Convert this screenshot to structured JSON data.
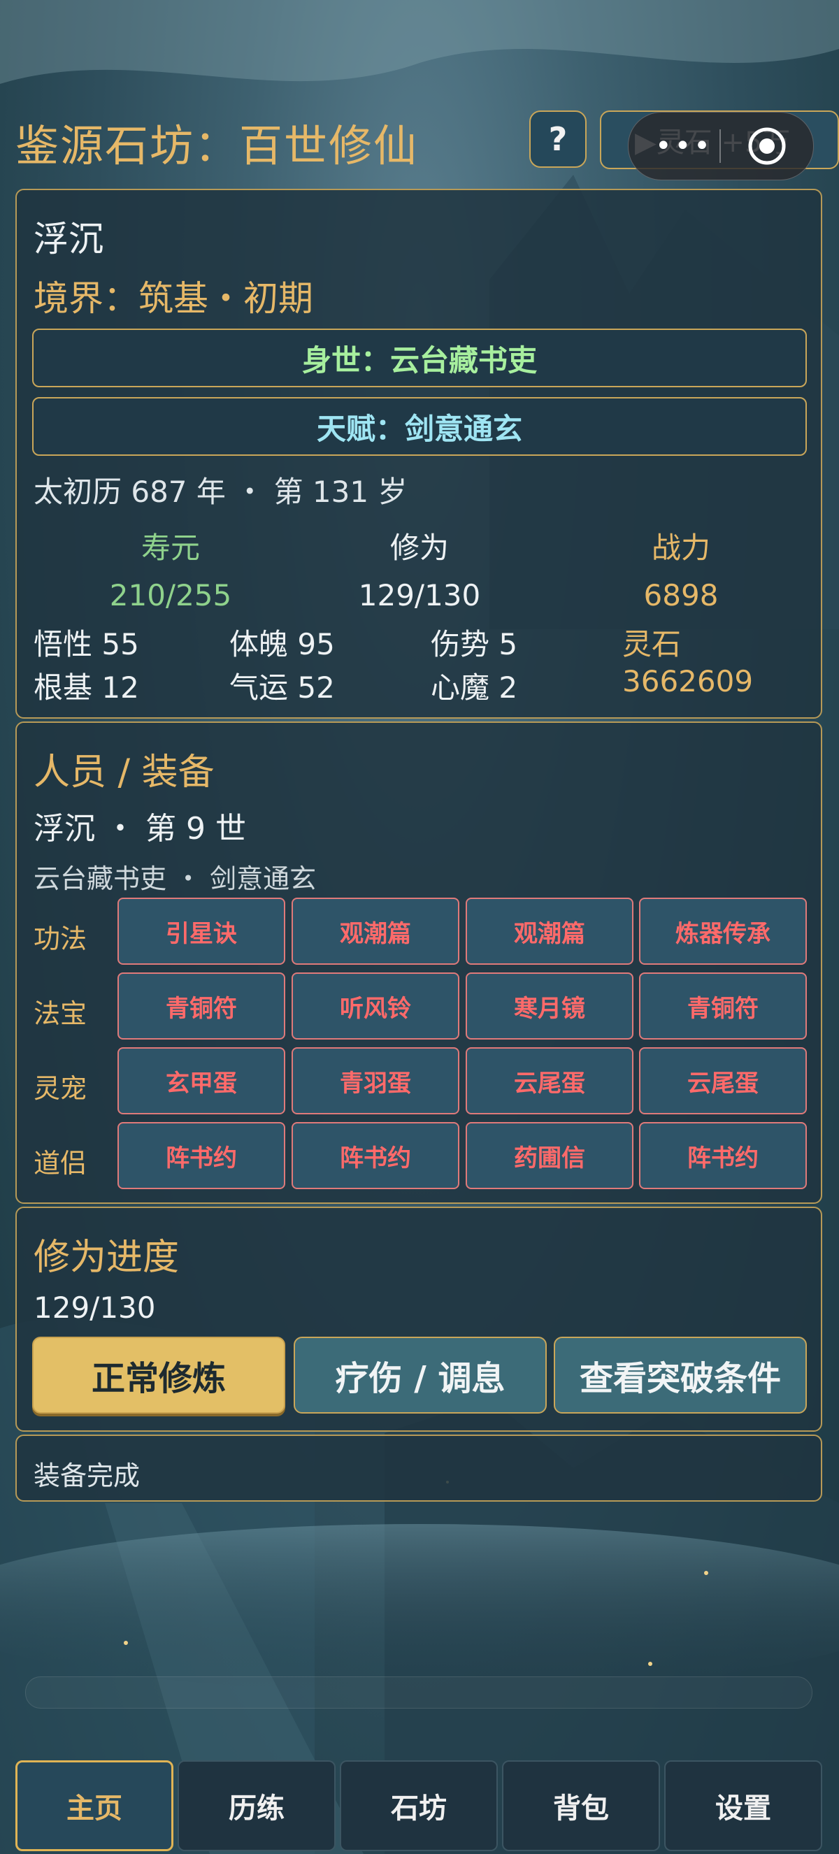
{
  "header": {
    "title": "鉴源石坊：百世修仙",
    "help_label": "?",
    "reward_label": "▶灵石 +5万"
  },
  "character": {
    "name": "浮沉",
    "realm": "境界：筑基・初期",
    "background": "身世：云台藏书吏",
    "talent": "天赋：剑意通玄",
    "date": "太初历 687 年 ・ 第 131 岁",
    "lifespan_label": "寿元",
    "lifespan_value": "210/255",
    "cultivation_label": "修为",
    "cultivation_value": "129/130",
    "power_label": "战力",
    "power_value": "6898",
    "comprehension": "悟性 55",
    "foundation": "根基 12",
    "physique": "体魄 95",
    "luck": "气运 52",
    "injury": "伤势 5",
    "demon": "心魔 2",
    "stones_label": "灵石",
    "stones_value": "3662609"
  },
  "equipment": {
    "title": "人员 / 装备",
    "life_line": "浮沉 ・ 第 9 世",
    "sub_line": "云台藏书吏 ・ 剑意通玄",
    "rows": [
      {
        "label": "功法",
        "items": [
          "引星诀",
          "观潮篇",
          "观潮篇",
          "炼器传承"
        ]
      },
      {
        "label": "法宝",
        "items": [
          "青铜符",
          "听风铃",
          "寒月镜",
          "青铜符"
        ]
      },
      {
        "label": "灵宠",
        "items": [
          "玄甲蛋",
          "青羽蛋",
          "云尾蛋",
          "云尾蛋"
        ]
      },
      {
        "label": "道侣",
        "items": [
          "阵书约",
          "阵书约",
          "药圃信",
          "阵书约"
        ]
      }
    ]
  },
  "progress": {
    "title": "修为进度",
    "value": "129/130",
    "actions": [
      "正常修炼",
      "疗伤 / 调息",
      "查看突破条件"
    ]
  },
  "log": {
    "text": "装备完成"
  },
  "nav": {
    "items": [
      "主页",
      "历练",
      "石坊",
      "背包",
      "设置"
    ],
    "active": 0
  },
  "colors": {
    "accent_gold": "#e6b868",
    "lifespan_green": "#8fd28c",
    "slot_red": "#ff6a6a",
    "talent_cyan": "#9fe5f3",
    "background_green": "#a7ef9e"
  }
}
